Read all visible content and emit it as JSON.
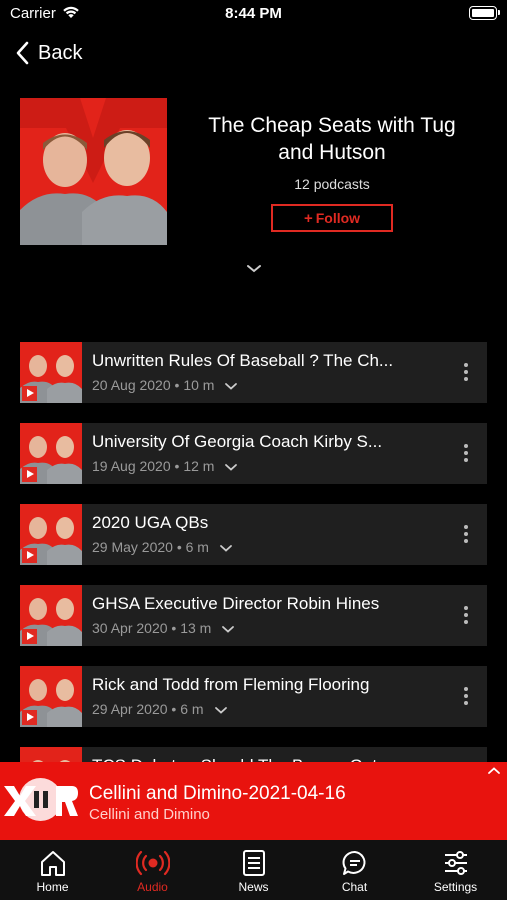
{
  "status_bar": {
    "carrier": "Carrier",
    "time": "8:44 PM"
  },
  "nav": {
    "back_label": "Back"
  },
  "podcast": {
    "title": "The Cheap Seats with Tug and Hutson",
    "count": "12 podcasts",
    "follow_label": "Follow",
    "follow_plus": "+"
  },
  "episodes": [
    {
      "title": "Unwritten Rules Of Baseball ? The Ch...",
      "meta": "20 Aug 2020 • 10 m"
    },
    {
      "title": "University Of Georgia Coach Kirby S...",
      "meta": "19 Aug 2020 • 12 m"
    },
    {
      "title": "2020 UGA QBs",
      "meta": "29 May 2020 • 6 m"
    },
    {
      "title": "GHSA Executive Director Robin Hines",
      "meta": "30 Apr 2020 • 13 m"
    },
    {
      "title": "Rick and Todd from Fleming Flooring",
      "meta": "29 Apr 2020 • 6 m"
    },
    {
      "title": "TCS Debate - Should The Braves Get...",
      "meta": ""
    }
  ],
  "now_playing": {
    "title": "Cellini and Dimino-2021-04-16",
    "subtitle": "Cellini and Dimino"
  },
  "tabs": [
    {
      "label": "Home",
      "icon": "home-icon"
    },
    {
      "label": "Audio",
      "icon": "audio-icon",
      "active": true
    },
    {
      "label": "News",
      "icon": "news-icon"
    },
    {
      "label": "Chat",
      "icon": "chat-icon"
    },
    {
      "label": "Settings",
      "icon": "settings-icon"
    }
  ],
  "colors": {
    "accent": "#e02a22",
    "now_playing_bg": "#e8130e",
    "row_bg": "#1f1f1f",
    "background": "#000000"
  }
}
